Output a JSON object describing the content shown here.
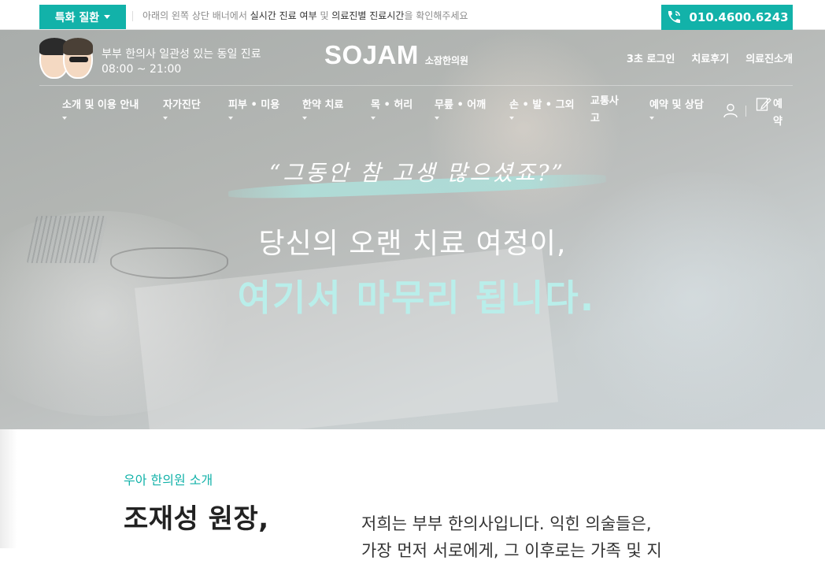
{
  "topbar": {
    "specialty_label": "특화 질환",
    "notice_pre": "아래의 왼쪽 상단 배너에서 ",
    "notice_em1": "실시간 진료 여부",
    "notice_mid": " 및 ",
    "notice_em2": "의료진별 진료시간",
    "notice_post": "을 확인해주세요",
    "phone": "010.4600.6243"
  },
  "brand": {
    "doctors_line": "부부 한의사  일관성 있는 동일 진료",
    "hours": "08:00 ~ 21:00",
    "logo_mark": "SOJAM",
    "logo_sub": "소잠한의원",
    "util_links": [
      "3초 로그인",
      "치료후기",
      "의료진소개"
    ]
  },
  "nav": {
    "items": [
      "소개 및 이용 안내",
      "자가진단",
      "피부 • 미용",
      "한약 치료",
      "목 • 허리",
      "무릎 • 어깨",
      "손 • 발 • 그외",
      "교통사고",
      "예약 및 상담"
    ],
    "reserve_label": "예약"
  },
  "hero": {
    "quote": "“그동안 참 고생 많으셨죠?”",
    "headline1": "당신의 오랜 치료 여정이,",
    "headline2": "여기서 마무리 됩니다."
  },
  "intro": {
    "label": "우아 한의원 소개",
    "title": "조재성 원장,",
    "text_line1": "저희는 부부 한의사입니다. 익힌 의술들은,",
    "text_line2": "가장 먼저 서로에게, 그 이후로는 가족 및 지"
  },
  "colors": {
    "accent": "#12b2a9",
    "headline_accent": "#b9eeea"
  }
}
